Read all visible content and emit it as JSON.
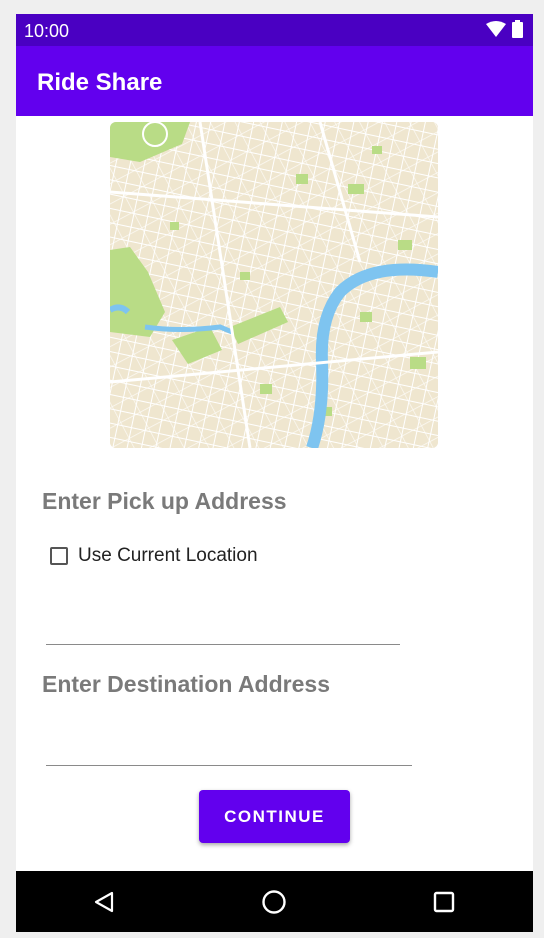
{
  "status_bar": {
    "time": "10:00",
    "icons": [
      "wifi-icon",
      "battery-icon"
    ]
  },
  "app_bar": {
    "title": "Ride Share"
  },
  "map": {
    "icon": "city-map-image"
  },
  "pickup": {
    "heading": "Enter Pick up Address",
    "use_current_location_label": "Use Current Location",
    "use_current_location_checked": false,
    "value": "",
    "placeholder": ""
  },
  "destination": {
    "heading": "Enter Destination Address",
    "value": "",
    "placeholder": ""
  },
  "actions": {
    "continue_label": "CONTINUE"
  },
  "nav_bar": {
    "icons": [
      "back-icon",
      "home-icon",
      "recents-icon"
    ]
  },
  "colors": {
    "primary": "#6200ee",
    "primary_dark": "#4a00c2",
    "heading_gray": "#7a7a7a",
    "map_land": "#efe6cf",
    "map_park": "#b9dc86",
    "map_water": "#7ec4f0"
  }
}
